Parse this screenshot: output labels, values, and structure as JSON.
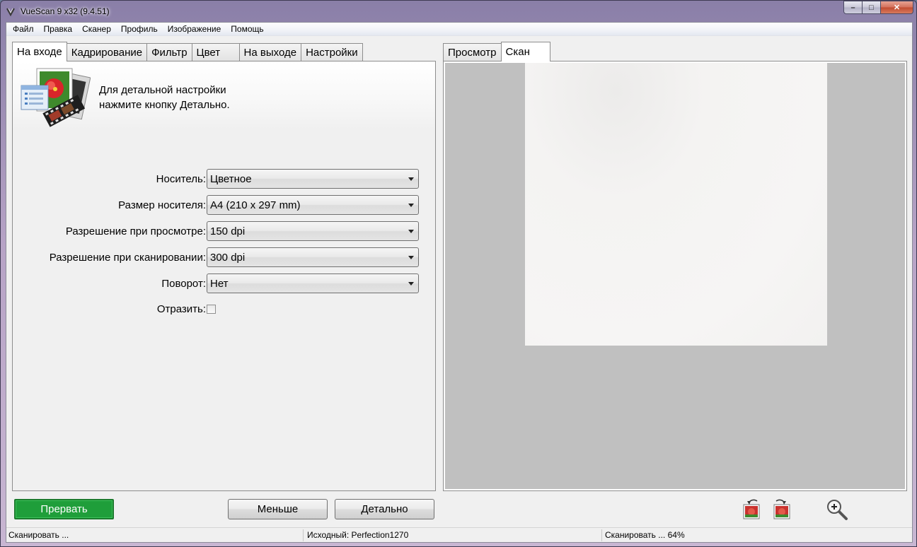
{
  "window": {
    "title": "VueScan 9 x32 (9.4.51)",
    "controls": {
      "minimize": "–",
      "maximize": "□",
      "close": "✕"
    }
  },
  "menu": [
    "Файл",
    "Правка",
    "Сканер",
    "Профиль",
    "Изображение",
    "Помощь"
  ],
  "left_tabs": [
    "На входе",
    "Кадрирование",
    "Фильтр",
    "Цвет",
    "На выходе",
    "Настройки"
  ],
  "left_active_tab": "На входе",
  "right_tabs": [
    "Просмотр",
    "Скан"
  ],
  "right_active_tab": "Скан",
  "hint": {
    "line1": "Для детальной настройки",
    "line2": "нажмите кнопку Детально."
  },
  "form": {
    "media_label": "Носитель:",
    "media_value": "Цветное",
    "media_size_label": "Размер носителя:",
    "media_size_value": "A4 (210 x 297 mm)",
    "preview_res_label": "Разрешение при просмотре:",
    "preview_res_value": "150 dpi",
    "scan_res_label": "Разрешение при сканировании:",
    "scan_res_value": "300 dpi",
    "rotation_label": "Поворот:",
    "rotation_value": "Нет",
    "mirror_label": "Отразить:",
    "mirror_checked": false
  },
  "buttons": {
    "stop": "Прервать",
    "less": "Меньше",
    "more": "Детально"
  },
  "toolbar_icons": [
    "rotate-left-icon",
    "rotate-right-icon",
    "zoom-in-icon"
  ],
  "status": {
    "left": "Сканировать ...",
    "middle": "Исходный: Perfection1270",
    "right": "Сканировать ... 64%"
  },
  "colors": {
    "stop_button": "#1f9e3a",
    "scan_background": "#c0c0c0"
  }
}
